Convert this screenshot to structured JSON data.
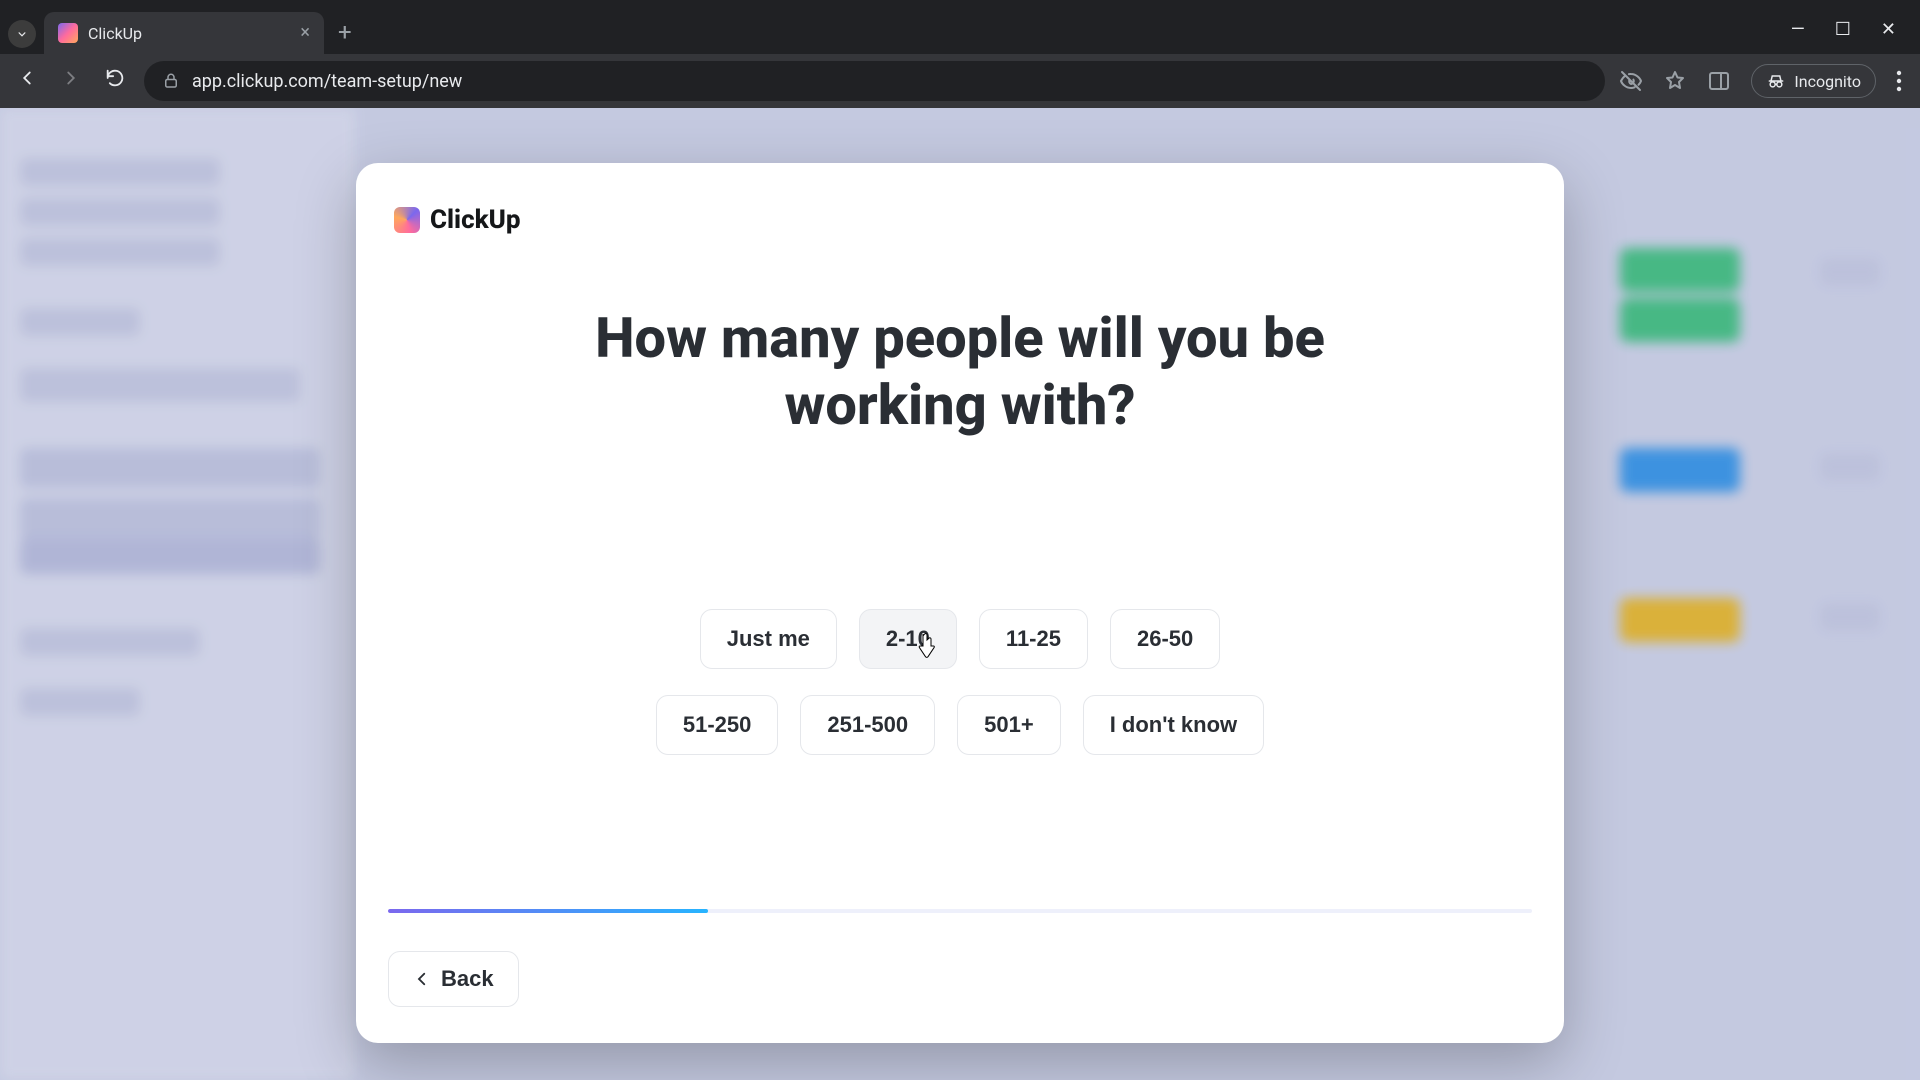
{
  "browser": {
    "tab_title": "ClickUp",
    "url": "app.clickup.com/team-setup/new",
    "incognito_label": "Incognito"
  },
  "brand": {
    "name": "ClickUp"
  },
  "question": {
    "title": "How many people will you be working with?"
  },
  "choices": {
    "row1": [
      "Just me",
      "2-10",
      "11-25",
      "26-50"
    ],
    "row2": [
      "51-250",
      "251-500",
      "501+",
      "I don't know"
    ]
  },
  "progress": {
    "percent": 28
  },
  "buttons": {
    "back": "Back"
  },
  "hovered_choice_index": 1
}
